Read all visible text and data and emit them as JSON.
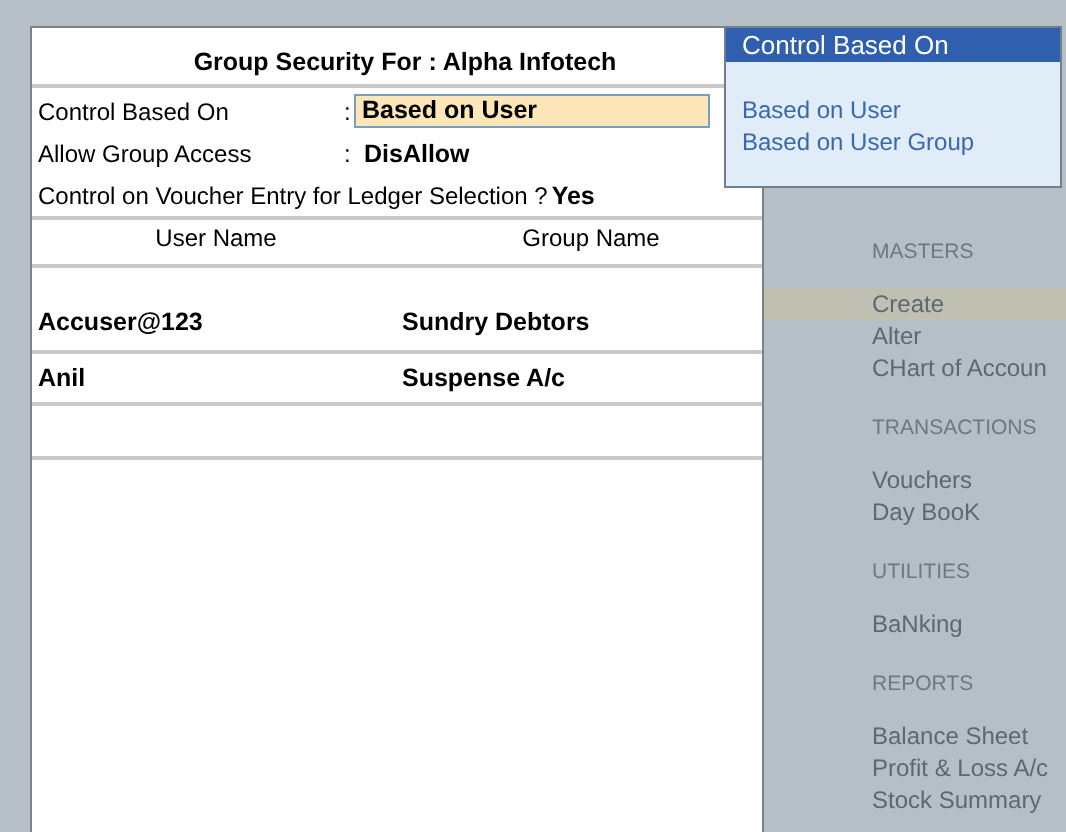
{
  "panel": {
    "title": "Group Security For : Alpha Infotech",
    "fields": [
      {
        "label": "Control Based On",
        "separator": ":",
        "value": "Based on User",
        "kind": "input"
      },
      {
        "label": "Allow Group Access",
        "separator": ":",
        "value": "DisAllow",
        "kind": "text"
      }
    ],
    "question": {
      "label": "Control on Voucher Entry for Ledger Selection ?",
      "value": "Yes"
    }
  },
  "table": {
    "columns": [
      "User Name",
      "Group Name"
    ],
    "rows": [
      [
        "Accuser@123",
        "Sundry Debtors"
      ],
      [
        "Anil",
        "Suspense A/c"
      ]
    ]
  },
  "popup": {
    "title": "Control Based On",
    "items": [
      "Based on User",
      "Based on User Group"
    ]
  },
  "background_menu": {
    "sections": [
      {
        "heading": "MASTERS",
        "items": [
          {
            "label": "Create",
            "selected": true
          },
          {
            "label": "Alter",
            "selected": false
          },
          {
            "label": "CHart of Accoun",
            "selected": false
          }
        ]
      },
      {
        "heading": "TRANSACTIONS",
        "items": [
          {
            "label": "Vouchers",
            "selected": false
          },
          {
            "label": "Day BooK",
            "selected": false
          }
        ]
      },
      {
        "heading": "UTILITIES",
        "items": [
          {
            "label": "BaNking",
            "selected": false
          }
        ]
      },
      {
        "heading": "REPORTS",
        "items": [
          {
            "label": "Balance Sheet",
            "selected": false
          },
          {
            "label": "Profit & Loss A/c",
            "selected": false
          },
          {
            "label": "Stock Summary",
            "selected": false
          }
        ]
      }
    ]
  }
}
